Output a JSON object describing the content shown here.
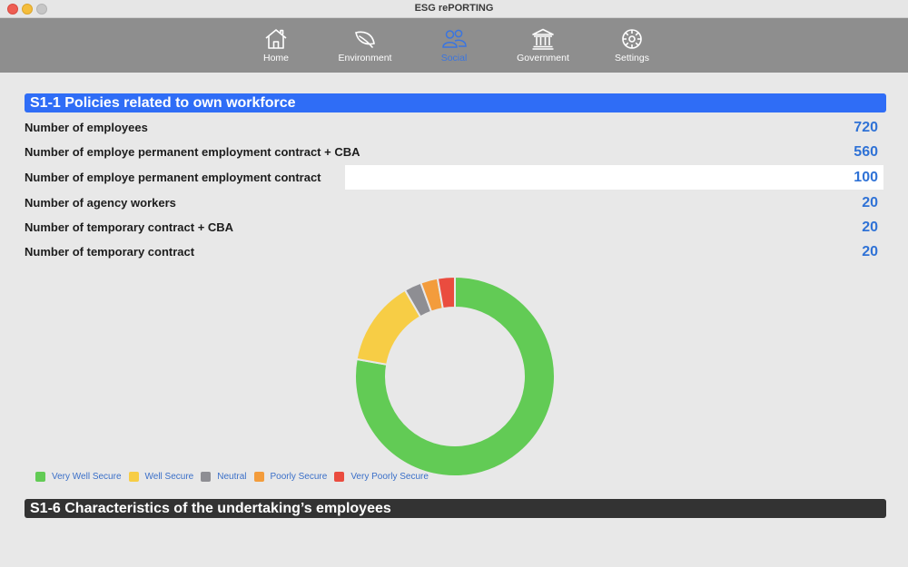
{
  "window": {
    "title": "ESG rePORTING"
  },
  "toolbar": {
    "tabs": [
      {
        "label": "Home",
        "icon": "house-icon"
      },
      {
        "label": "Environment",
        "icon": "leaf-icon"
      },
      {
        "label": "Social",
        "icon": "people-icon",
        "active": true
      },
      {
        "label": "Government",
        "icon": "bank-icon"
      },
      {
        "label": "Settings",
        "icon": "gear-icon"
      }
    ]
  },
  "sections": {
    "s1_1": "S1-1 Policies related to own workforce",
    "s1_6": "S1-6 Characteristics of the undertaking’s employees"
  },
  "rows": [
    {
      "label": "Number of employees",
      "value": "720"
    },
    {
      "label": "Number of employe permanent employment contract + CBA",
      "value": "560"
    },
    {
      "label": "Number of employe permanent employment contract",
      "value": "100"
    },
    {
      "label": "Number of agency workers",
      "value": "20"
    },
    {
      "label": "Number of temporary contract + CBA",
      "value": "20"
    },
    {
      "label": "Number of temporary contract",
      "value": "20"
    }
  ],
  "chart_data": {
    "type": "pie",
    "categories": [
      "Very Well Secure",
      "Well Secure",
      "Neutral",
      "Poorly Secure",
      "Very Poorly Secure"
    ],
    "values": [
      560,
      100,
      20,
      20,
      20
    ],
    "colors": [
      "#62cb55",
      "#f7cd45",
      "#8e8e93",
      "#f39c3c",
      "#ea4c3f"
    ],
    "legend": "bottom-left",
    "title": "",
    "xlabel": "",
    "ylabel": ""
  }
}
